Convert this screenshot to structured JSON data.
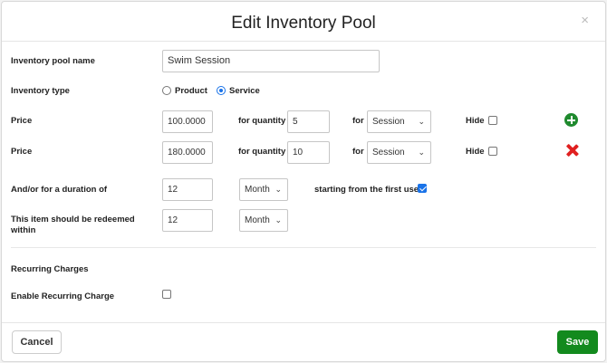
{
  "dialog": {
    "title": "Edit Inventory Pool",
    "close_glyph": "×"
  },
  "fields": {
    "pool_name_label": "Inventory pool name",
    "pool_name_value": "Swim Session",
    "type_label": "Inventory type",
    "type_options": [
      "Product",
      "Service"
    ],
    "type_selected": "Service",
    "prices": [
      {
        "label": "Price",
        "price": "100.0000",
        "qty_label": "for quantity",
        "qty": "5",
        "for_label": "for",
        "unit": "Session",
        "hide_label": "Hide",
        "hide_checked": false,
        "action": "add"
      },
      {
        "label": "Price",
        "price": "180.0000",
        "qty_label": "for quantity",
        "qty": "10",
        "for_label": "for",
        "unit": "Session",
        "hide_label": "Hide",
        "hide_checked": false,
        "action": "remove"
      }
    ],
    "duration_label": "And/or for a duration of",
    "duration_value": "12",
    "duration_unit": "Month",
    "first_use_label": "starting from the first use",
    "first_use_checked": true,
    "redeem_label": "This item should be redeemed within",
    "redeem_value": "12",
    "redeem_unit": "Month"
  },
  "recurring": {
    "section_label": "Recurring Charges",
    "enable_label": "Enable Recurring Charge",
    "enable_checked": false
  },
  "footer": {
    "cancel_label": "Cancel",
    "save_label": "Save"
  },
  "colors": {
    "accent_blue": "#1a73e8",
    "save_green": "#138a1e",
    "add_green": "#1f8a2e",
    "remove_red": "#e02020"
  },
  "icons": {
    "add": "plus-circle-icon",
    "remove": "x-icon",
    "dropdown": "chevron-down-icon",
    "close": "close-icon"
  }
}
